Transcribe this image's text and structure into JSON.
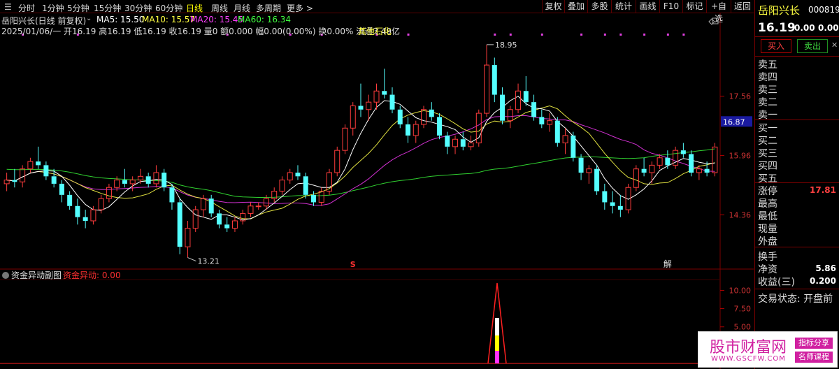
{
  "toolbar": {
    "periods": [
      "分时",
      "1分钟",
      "5分钟",
      "15分钟",
      "30分钟",
      "60分钟",
      "日线",
      "周线",
      "月线",
      "多周期",
      "更多 >"
    ],
    "active_period": "日线",
    "right_buttons": [
      "复权",
      "叠加",
      "多股",
      "统计",
      "画线",
      "F10",
      "标记",
      "+自选",
      "返回"
    ]
  },
  "header": {
    "stock_name": "岳阳兴长(日线 前复权)",
    "ma5": "MA5: 15.50",
    "ma10": "MA10: 15.57",
    "ma20": "MA20: 15.45",
    "ma60": "MA60: 16.34",
    "ohlc_line": "2025/01/06/一 开16.19 高16.19 低16.19 收16.19 量0 额0.000 幅0.00(0.00%) 换0.00% 流通3.49亿",
    "sector": "其他石化"
  },
  "price_axis": {
    "ticks": [
      "17.56",
      "15.96",
      "14.36"
    ],
    "current_box": "16.87",
    "high_label": "18.95",
    "low_label": "13.21"
  },
  "markers": {
    "s_label": "S",
    "jie_label": "解"
  },
  "indicator": {
    "name": "资金异动副图",
    "value_label": "资金异动: 0.00",
    "ticks": [
      "10.00",
      "7.50",
      "5.00"
    ]
  },
  "quote": {
    "name": "岳阳兴长",
    "code": "000819",
    "price": "16.19",
    "change": "0.00",
    "change_pct": "0.00%",
    "buy_button": "买入",
    "sell_button": "卖出",
    "sell_levels": [
      "卖五",
      "卖四",
      "卖三",
      "卖二",
      "卖一"
    ],
    "buy_levels": [
      "买一",
      "买二",
      "买三",
      "买四",
      "买五"
    ],
    "stats": [
      {
        "label": "涨停",
        "value": "17.81"
      },
      {
        "label": "最高",
        "value": ""
      },
      {
        "label": "最低",
        "value": ""
      },
      {
        "label": "现量",
        "value": ""
      },
      {
        "label": "外盘",
        "value": ""
      },
      {
        "label": "换手",
        "value": ""
      },
      {
        "label": "净资",
        "value": "5.86"
      },
      {
        "label": "收益(三)",
        "value": "0.200"
      }
    ],
    "trade_status": "交易状态: 开盘前"
  },
  "watermark": {
    "title": "股市财富网",
    "url": "WWW.GSCFW.COM",
    "tag1": "指标分享",
    "tag2": "名师课程"
  },
  "chart_data": {
    "type": "candlestick",
    "title": "岳阳兴长(日线 前复权)",
    "price_range": [
      12.9,
      19.4
    ],
    "price_ticks": [
      17.56,
      15.96,
      14.36
    ],
    "annotated_high": 18.95,
    "annotated_low": 13.21,
    "candles": [
      [
        15.2,
        15.5,
        15.0,
        15.3
      ],
      [
        15.3,
        15.6,
        15.1,
        15.25
      ],
      [
        15.25,
        15.7,
        15.1,
        15.6
      ],
      [
        15.6,
        15.9,
        15.5,
        15.8
      ],
      [
        15.8,
        16.2,
        15.6,
        15.7
      ],
      [
        15.7,
        15.8,
        15.3,
        15.4
      ],
      [
        15.4,
        15.6,
        15.1,
        15.2
      ],
      [
        15.2,
        15.3,
        14.7,
        14.9
      ],
      [
        14.9,
        15.0,
        14.5,
        14.6
      ],
      [
        14.6,
        14.8,
        14.1,
        14.3
      ],
      [
        14.3,
        14.5,
        14.0,
        14.2
      ],
      [
        14.2,
        14.6,
        14.1,
        14.5
      ],
      [
        14.5,
        14.9,
        14.4,
        14.8
      ],
      [
        14.8,
        15.2,
        14.7,
        15.1
      ],
      [
        15.1,
        15.4,
        15.0,
        15.3
      ],
      [
        15.3,
        15.6,
        15.1,
        15.2
      ],
      [
        15.2,
        15.4,
        15.0,
        15.3
      ],
      [
        15.3,
        15.6,
        15.2,
        15.4
      ],
      [
        15.4,
        15.5,
        15.1,
        15.2
      ],
      [
        15.2,
        15.7,
        15.1,
        15.5
      ],
      [
        15.5,
        15.6,
        15.0,
        15.1
      ],
      [
        15.1,
        15.2,
        14.5,
        14.7
      ],
      [
        14.7,
        14.8,
        13.3,
        13.5
      ],
      [
        13.5,
        14.2,
        13.21,
        14.0
      ],
      [
        14.0,
        14.6,
        13.9,
        14.5
      ],
      [
        14.5,
        14.9,
        14.3,
        14.8
      ],
      [
        14.8,
        14.9,
        14.3,
        14.4
      ],
      [
        14.4,
        14.5,
        14.0,
        14.1
      ],
      [
        14.1,
        14.3,
        13.9,
        14.0
      ],
      [
        14.0,
        14.3,
        13.9,
        14.2
      ],
      [
        14.2,
        14.5,
        14.1,
        14.4
      ],
      [
        14.4,
        14.7,
        14.3,
        14.6
      ],
      [
        14.6,
        14.7,
        14.5,
        14.6
      ],
      [
        14.6,
        14.9,
        14.5,
        14.8
      ],
      [
        14.8,
        15.1,
        14.7,
        15.0
      ],
      [
        15.0,
        15.4,
        14.9,
        15.3
      ],
      [
        15.3,
        15.6,
        15.2,
        15.5
      ],
      [
        15.5,
        15.7,
        15.3,
        15.4
      ],
      [
        15.4,
        15.5,
        14.8,
        14.9
      ],
      [
        14.9,
        15.0,
        14.6,
        14.7
      ],
      [
        14.7,
        15.1,
        14.6,
        15.0
      ],
      [
        15.0,
        15.6,
        14.9,
        15.5
      ],
      [
        15.5,
        16.2,
        15.4,
        16.1
      ],
      [
        16.1,
        16.8,
        16.0,
        16.7
      ],
      [
        16.7,
        17.4,
        16.5,
        17.3
      ],
      [
        17.3,
        17.9,
        17.0,
        17.2
      ],
      [
        17.2,
        17.6,
        16.9,
        17.4
      ],
      [
        17.4,
        17.9,
        17.2,
        17.7
      ],
      [
        17.7,
        18.3,
        17.5,
        17.6
      ],
      [
        17.6,
        17.8,
        17.1,
        17.2
      ],
      [
        17.2,
        17.3,
        16.7,
        16.8
      ],
      [
        16.8,
        17.0,
        16.3,
        16.5
      ],
      [
        16.5,
        16.9,
        16.3,
        16.8
      ],
      [
        16.8,
        17.3,
        16.7,
        17.2
      ],
      [
        17.2,
        17.4,
        16.9,
        17.0
      ],
      [
        17.0,
        17.1,
        16.4,
        16.5
      ],
      [
        16.5,
        16.6,
        16.0,
        16.2
      ],
      [
        16.2,
        16.5,
        16.0,
        16.4
      ],
      [
        16.4,
        16.6,
        16.1,
        16.2
      ],
      [
        16.2,
        16.5,
        16.1,
        16.3
      ],
      [
        16.3,
        17.2,
        16.2,
        17.1
      ],
      [
        17.1,
        18.95,
        17.0,
        18.4
      ],
      [
        18.4,
        18.6,
        17.4,
        17.6
      ],
      [
        17.6,
        17.8,
        16.8,
        16.9
      ],
      [
        16.9,
        17.3,
        16.7,
        17.2
      ],
      [
        17.2,
        17.9,
        17.1,
        17.7
      ],
      [
        17.7,
        18.1,
        17.3,
        17.4
      ],
      [
        17.4,
        17.6,
        16.9,
        17.0
      ],
      [
        17.0,
        17.2,
        16.7,
        16.8
      ],
      [
        16.8,
        17.1,
        16.6,
        16.9
      ],
      [
        16.9,
        17.0,
        16.2,
        16.3
      ],
      [
        16.3,
        16.7,
        16.0,
        16.5
      ],
      [
        16.5,
        16.6,
        15.8,
        15.9
      ],
      [
        15.9,
        16.0,
        15.3,
        15.5
      ],
      [
        15.5,
        15.7,
        15.2,
        15.6
      ],
      [
        15.6,
        15.7,
        14.9,
        15.0
      ],
      [
        15.0,
        15.2,
        14.5,
        14.7
      ],
      [
        14.7,
        15.0,
        14.4,
        14.6
      ],
      [
        14.6,
        14.9,
        14.3,
        14.5
      ],
      [
        14.5,
        15.2,
        14.4,
        15.1
      ],
      [
        15.1,
        15.7,
        15.0,
        15.6
      ],
      [
        15.6,
        15.9,
        15.4,
        15.5
      ],
      [
        15.5,
        15.8,
        15.2,
        15.7
      ],
      [
        15.7,
        16.0,
        15.6,
        15.9
      ],
      [
        15.9,
        16.1,
        15.6,
        15.7
      ],
      [
        15.7,
        16.2,
        15.6,
        16.1
      ],
      [
        16.1,
        16.3,
        15.9,
        16.0
      ],
      [
        16.0,
        16.1,
        15.4,
        15.5
      ],
      [
        15.5,
        15.7,
        15.3,
        15.6
      ],
      [
        15.6,
        15.8,
        15.4,
        15.5
      ],
      [
        15.5,
        16.3,
        15.4,
        16.19
      ]
    ],
    "indicator_series": {
      "name": "资金异动",
      "current": 0.0,
      "peak": 10.0,
      "ylim": [
        0,
        11
      ]
    }
  }
}
